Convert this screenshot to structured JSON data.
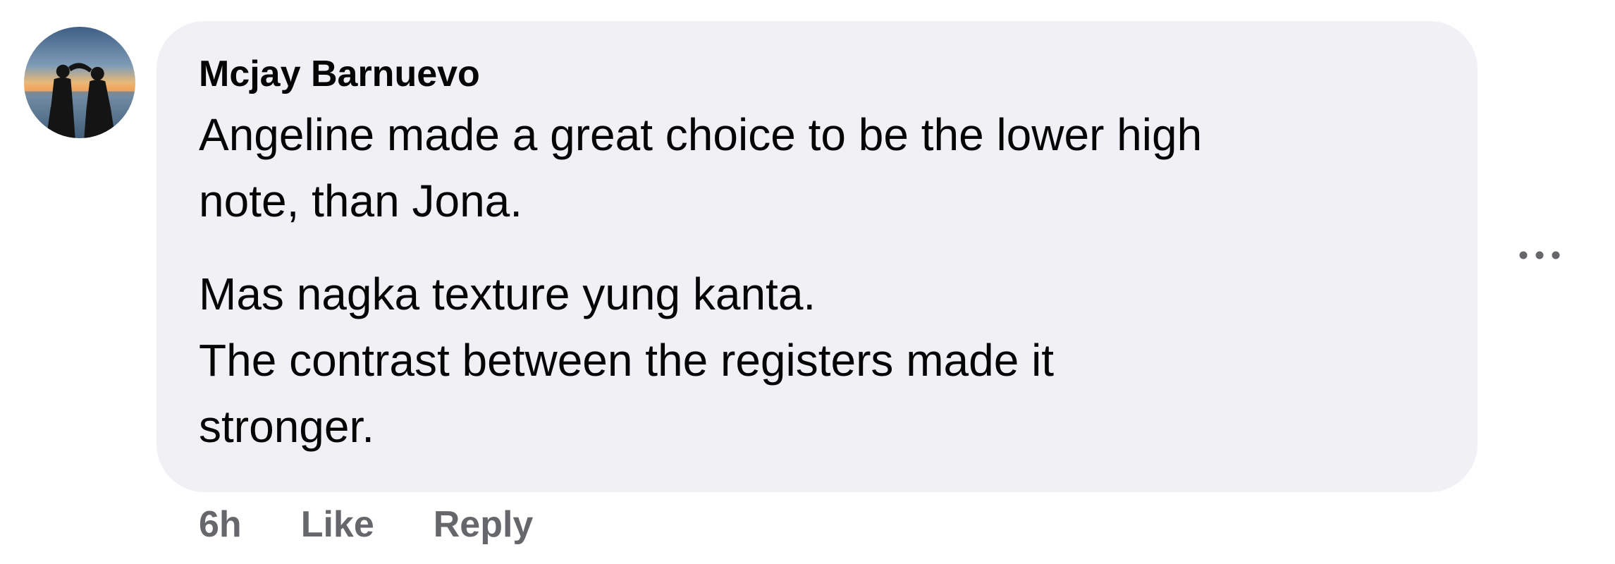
{
  "comment": {
    "author": "Mcjay Barnuevo",
    "paragraphs": [
      "Angeline made a great choice to be the lower high\nnote, than Jona.",
      "Mas nagka texture yung kanta.\nThe contrast between the registers made it\nstronger."
    ],
    "timestamp": "6h",
    "like_label": "Like",
    "reply_label": "Reply",
    "more_icon": "more-horizontal-icon",
    "avatar_icon": "profile-photo"
  },
  "colors": {
    "bubble_bg": "#f0f0f5",
    "text": "#050505",
    "meta_text": "#65676b"
  }
}
